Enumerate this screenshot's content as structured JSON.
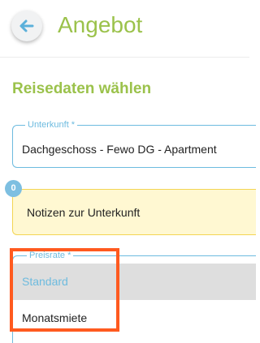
{
  "header": {
    "title": "Angebot"
  },
  "section": {
    "title": "Reisedaten wählen"
  },
  "accommodation": {
    "label": "Unterkunft *",
    "value": "Dachgeschoss - Fewo DG - Apartment"
  },
  "notes": {
    "label": "Notizen zur Unterkunft",
    "count": "0"
  },
  "rate": {
    "label": "Preisrate *",
    "options": [
      {
        "label": "Standard",
        "selected": true
      },
      {
        "label": "Monatsmiete",
        "selected": false
      }
    ]
  },
  "colors": {
    "accent": "#9bc24b",
    "field_border": "#6dbbdf",
    "highlight": "#ff5a1f",
    "notes_bg": "#fff8d2"
  }
}
